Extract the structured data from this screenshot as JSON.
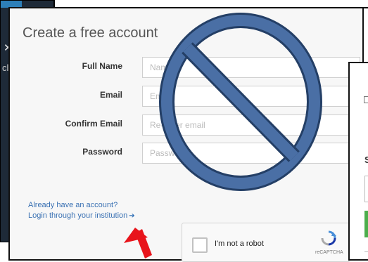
{
  "form": {
    "title": "Create a free account",
    "fields": [
      {
        "label": "Full Name",
        "placeholder": "Name"
      },
      {
        "label": "Email",
        "placeholder": "Email"
      },
      {
        "label": "Confirm Email",
        "placeholder": "Re-enter email"
      },
      {
        "label": "Password",
        "placeholder": "Password"
      }
    ],
    "already_text": "Already have an account?",
    "institution_link": "Login through your institution"
  },
  "captcha": {
    "label": "I'm not a robot",
    "brand": "reCAPTCHA"
  },
  "side_window": {
    "heading_letter": "S"
  },
  "colors": {
    "link": "#3a71b3",
    "prohibition_sign": "#4a6fa5",
    "arrow": "#e8141b",
    "button_green": "#4cae4c"
  }
}
